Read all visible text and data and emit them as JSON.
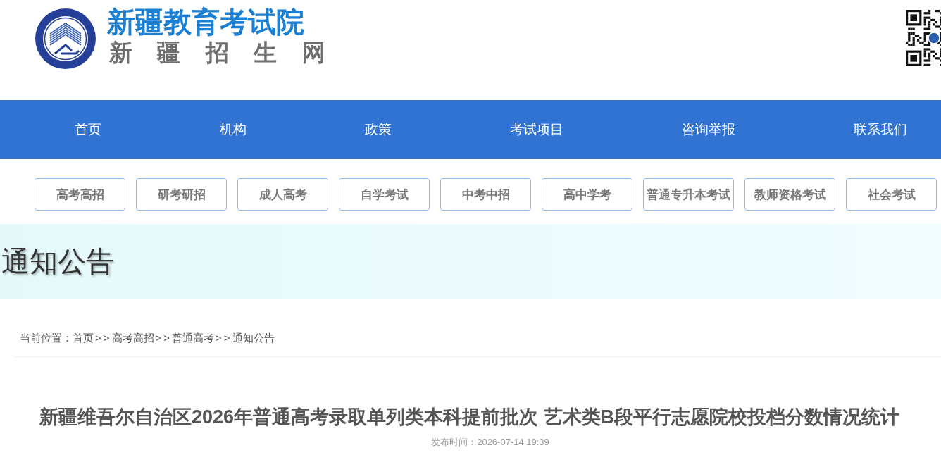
{
  "header": {
    "site_title": "新疆教育考试院",
    "site_subtitle": "新 疆 招 生 网"
  },
  "main_nav": [
    {
      "label": "首页"
    },
    {
      "label": "机构"
    },
    {
      "label": "政策"
    },
    {
      "label": "考试项目"
    },
    {
      "label": "咨询举报"
    },
    {
      "label": "联系我们"
    }
  ],
  "exam_categories": [
    {
      "label": "高考高招"
    },
    {
      "label": "研考研招"
    },
    {
      "label": "成人高考"
    },
    {
      "label": "自学考试"
    },
    {
      "label": "中考中招"
    },
    {
      "label": "高中学考"
    },
    {
      "label": "普通专升本考试"
    },
    {
      "label": "教师资格考试"
    },
    {
      "label": "社会考试"
    }
  ],
  "banner": {
    "title": "通知公告"
  },
  "breadcrumb": {
    "label": "当前位置：",
    "items": [
      {
        "label": "首页"
      },
      {
        "label": "高考高招"
      },
      {
        "label": "普通高考"
      },
      {
        "label": "通知公告"
      }
    ],
    "separators": [
      ">>",
      ">>",
      ">>"
    ]
  },
  "article": {
    "title": "新疆维吾尔自治区2026年普通高考录取单列类本科提前批次 艺术类B段平行志愿院校投档分数情况统计",
    "publish_time": "发布时间：2026-07-14 19:39"
  }
}
